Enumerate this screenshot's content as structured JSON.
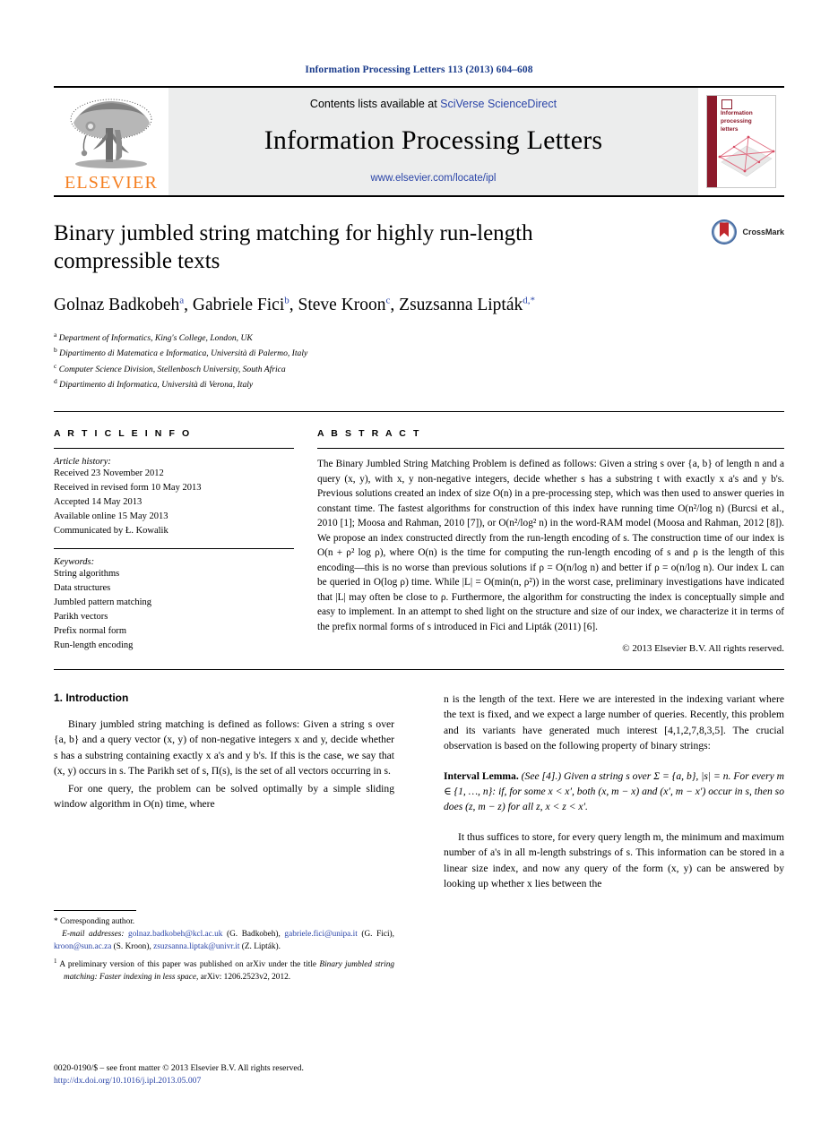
{
  "running_head": "Information Processing Letters 113 (2013) 604–608",
  "masthead": {
    "publisher_name": "ELSEVIER",
    "contents_prefix": "Contents lists available at",
    "contents_link": "SciVerse ScienceDirect",
    "journal_title": "Information Processing Letters",
    "journal_url": "www.elsevier.com/locate/ipl",
    "cover_title_line1": "Information",
    "cover_title_line2": "processing",
    "cover_title_line3": "letters"
  },
  "article": {
    "title": "Binary jumbled string matching for highly run-length compressible texts",
    "crossmark_label": "CrossMark",
    "authors": [
      {
        "name": "Golnaz Badkobeh",
        "marker": "a"
      },
      {
        "name": "Gabriele Fici",
        "marker": "b"
      },
      {
        "name": "Steve Kroon",
        "marker": "c"
      },
      {
        "name": "Zsuzsanna Lipták",
        "marker": "d,*"
      }
    ],
    "affiliations": [
      {
        "marker": "a",
        "text": "Department of Informatics, King's College, London, UK"
      },
      {
        "marker": "b",
        "text": "Dipartimento di Matematica e Informatica, Università di Palermo, Italy"
      },
      {
        "marker": "c",
        "text": "Computer Science Division, Stellenbosch University, South Africa"
      },
      {
        "marker": "d",
        "text": "Dipartimento di Informatica, Università di Verona, Italy"
      }
    ]
  },
  "info": {
    "heading": "A R T I C L E   I N F O",
    "history_label": "Article history:",
    "history": [
      "Received 23 November 2012",
      "Received in revised form 10 May 2013",
      "Accepted 14 May 2013",
      "Available online 15 May 2013",
      "Communicated by Ł. Kowalik"
    ],
    "keywords_label": "Keywords:",
    "keywords": [
      "String algorithms",
      "Data structures",
      "Jumbled pattern matching",
      "Parikh vectors",
      "Prefix normal form",
      "Run-length encoding"
    ]
  },
  "abstract": {
    "heading": "A B S T R A C T",
    "paragraph_1": "The Binary Jumbled String Matching Problem is defined as follows: Given a string s over {a, b} of length n and a query (x, y), with x, y non-negative integers, decide whether s has a substring t with exactly x a's and y b's. Previous solutions created an index of size O(n) in a pre-processing step, which was then used to answer queries in constant time. The fastest algorithms for construction of this index have running time O(n²/log n) (Burcsi et al., 2010 [1]; Moosa and Rahman, 2010 [7]), or O(n²/log² n) in the word-RAM model (Moosa and Rahman, 2012 [8]). We propose an index constructed directly from the run-length encoding of s. The construction time of our index is O(n + ρ² log ρ), where O(n) is the time for computing the run-length encoding of s and ρ is the length of this encoding—this is no worse than previous solutions if ρ = O(n/log n) and better if ρ = o(n/log n). Our index L can be queried in O(log ρ) time. While |L| = O(min(n, ρ²)) in the worst case, preliminary investigations have indicated that |L| may often be close to ρ. Furthermore, the algorithm for constructing the index is conceptually simple and easy to implement. In an attempt to shed light on the structure and size of our index, we characterize it in terms of the prefix normal forms of s introduced in Fici and Lipták (2011) [6].",
    "copyright": "© 2013 Elsevier B.V. All rights reserved."
  },
  "body": {
    "section_heading": "1. Introduction",
    "left_paragraph_1": "Binary jumbled string matching is defined as follows: Given a string s over {a, b} and a query vector (x, y) of non-negative integers x and y, decide whether s has a substring containing exactly x a's and y b's. If this is the case, we say that (x, y) occurs in s. The Parikh set of s, Π(s), is the set of all vectors occurring in s.",
    "left_paragraph_2": "For one query, the problem can be solved optimally by a simple sliding window algorithm in O(n) time, where",
    "right_paragraph_1": "n is the length of the text. Here we are interested in the indexing variant where the text is fixed, and we expect a large number of queries. Recently, this problem and its variants have generated much interest [4,1,2,7,8,3,5]. The crucial observation is based on the following property of binary strings:",
    "lemma_name": "Interval Lemma.",
    "lemma_text": "(See [4].) Given a string s over Σ = {a, b}, |s| = n. For every m ∈ {1, …, n}: if, for some x < x′, both (x, m − x) and (x′, m − x′) occur in s, then so does (z, m − z) for all z, x < z < x′.",
    "right_paragraph_2": "It thus suffices to store, for every query length m, the minimum and maximum number of a's in all m-length substrings of s. This information can be stored in a linear size index, and now any query of the form (x, y) can be answered by looking up whether x lies between the"
  },
  "footnotes": {
    "corresponding_marker": "*",
    "corresponding_text": "Corresponding author.",
    "email_label": "E-mail addresses:",
    "emails": [
      {
        "address": "golnaz.badkobeh@kcl.ac.uk",
        "owner": "(G. Badkobeh)"
      },
      {
        "address": "gabriele.fici@unipa.it",
        "owner": "(G. Fici)"
      },
      {
        "address": "kroon@sun.ac.za",
        "owner": "(S. Kroon)"
      },
      {
        "address": "zsuzsanna.liptak@univr.it",
        "owner": "(Z. Lipták)"
      }
    ],
    "note_marker": "1",
    "note_text_before": "A preliminary version of this paper was published on arXiv under the title",
    "note_title": "Binary jumbled string matching: Faster indexing in less space,",
    "note_text_after": "arXiv: 1206.2523v2, 2012."
  },
  "imprint": {
    "issn_line": "0020-0190/$ – see front matter © 2013 Elsevier B.V. All rights reserved.",
    "doi": "http://dx.doi.org/10.1016/j.ipl.2013.05.007"
  },
  "colors": {
    "journal_blue": "#1b3c8c",
    "link_blue": "#2b45a8",
    "elsevier_orange": "#f57f20",
    "masthead_gray": "#eceded",
    "cover_red": "#8c1a2b"
  }
}
